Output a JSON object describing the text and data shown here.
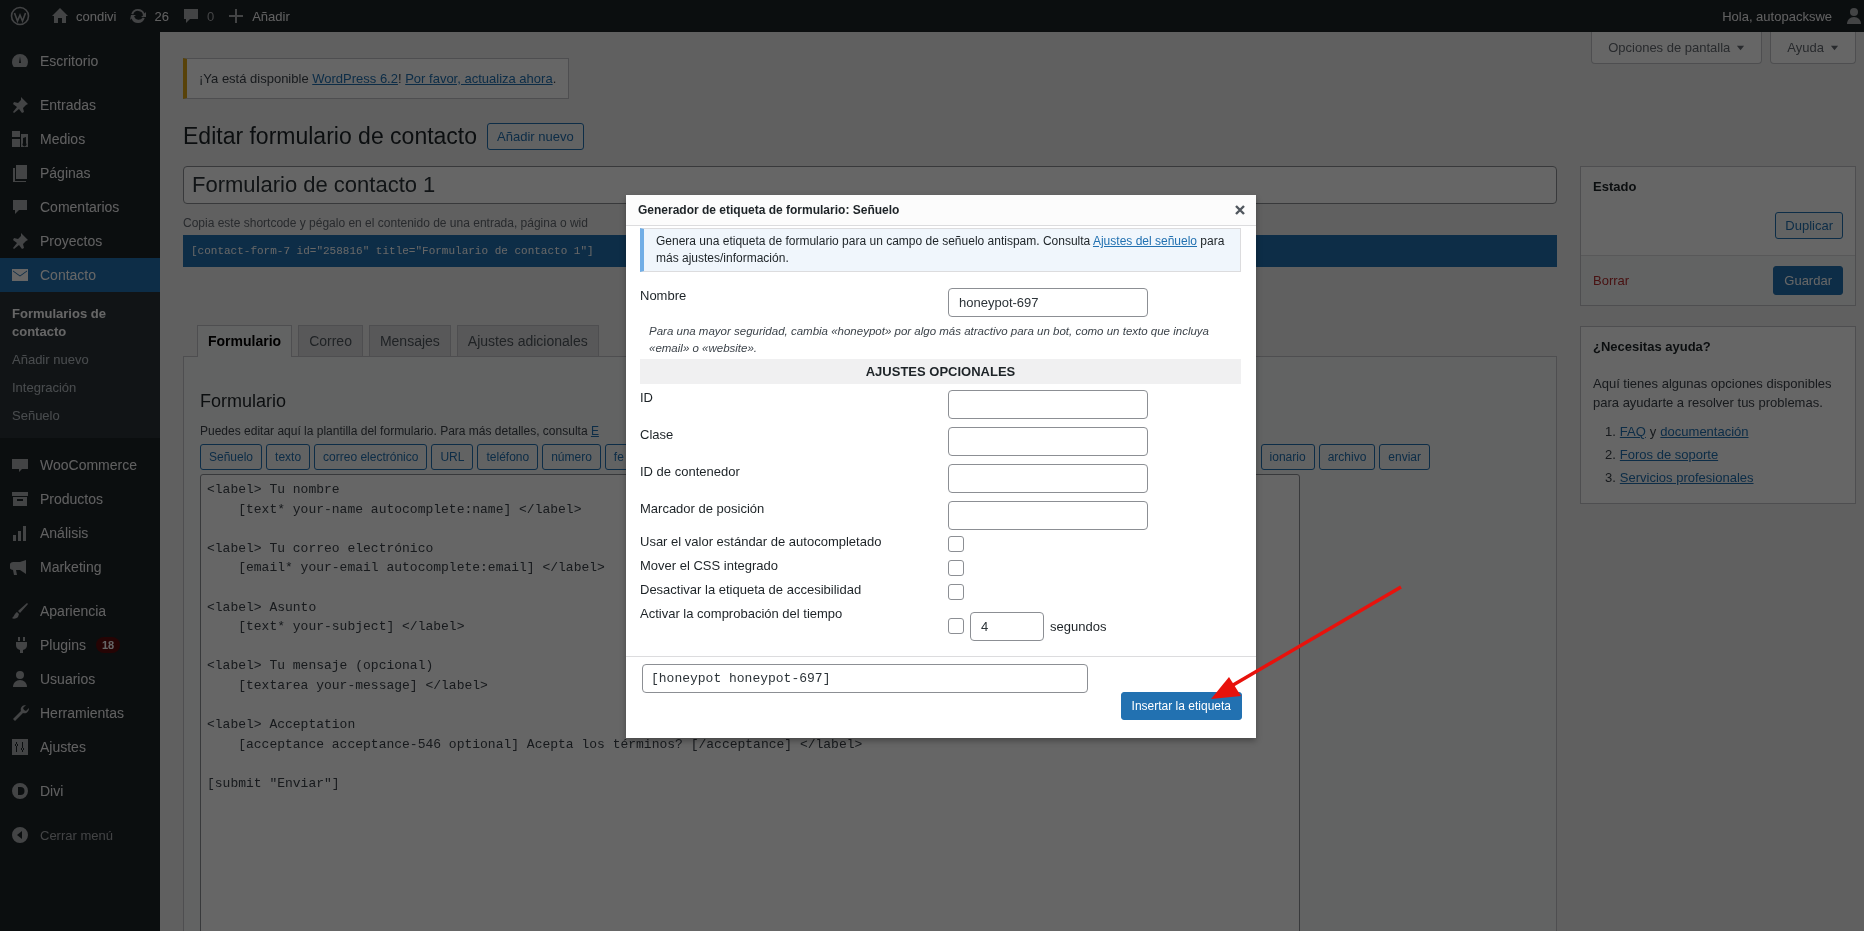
{
  "admin_bar": {
    "site": "condivi",
    "updates": "26",
    "comments": "0",
    "new": "Añadir",
    "greeting": "Hola, autopackswe"
  },
  "sidebar": {
    "groups": [
      [
        {
          "label": "Escritorio",
          "selected": false
        }
      ],
      [
        {
          "label": "Entradas",
          "selected": false
        },
        {
          "label": "Medios",
          "selected": false
        },
        {
          "label": "Páginas",
          "selected": false
        },
        {
          "label": "Comentarios",
          "selected": false
        },
        {
          "label": "Proyectos",
          "selected": false
        },
        {
          "label": "Contacto",
          "selected": true,
          "children": [
            {
              "label": "Formularios de contacto",
              "selected": true
            },
            {
              "label": "Añadir nuevo",
              "selected": false
            },
            {
              "label": "Integración",
              "selected": false
            },
            {
              "label": "Señuelo",
              "selected": false
            }
          ]
        }
      ],
      [
        {
          "label": "WooCommerce",
          "selected": false
        },
        {
          "label": "Productos",
          "selected": false
        },
        {
          "label": "Análisis",
          "selected": false
        },
        {
          "label": "Marketing",
          "selected": false
        }
      ],
      [
        {
          "label": "Apariencia",
          "selected": false
        },
        {
          "label": "Plugins",
          "selected": false,
          "badge": "18"
        },
        {
          "label": "Usuarios",
          "selected": false
        },
        {
          "label": "Herramientas",
          "selected": false
        },
        {
          "label": "Ajustes",
          "selected": false
        }
      ],
      [
        {
          "label": "Divi",
          "selected": false
        }
      ]
    ],
    "collapse_label": "Cerrar menú"
  },
  "screen_meta": [
    "Opciones de pantalla",
    "Ayuda"
  ],
  "notice": {
    "before": "¡Ya está disponible ",
    "link": "WordPress 6.2",
    "middle": "! ",
    "action": "Por favor, actualiza ahora",
    "after": "."
  },
  "page_title": "Editar formulario de contacto",
  "add_new": "Añadir nuevo",
  "form_title": "Formulario de contacto 1",
  "shortcode_hint": "Copia este shortcode y pégalo en el contenido de una entrada, página o wid",
  "shortcode": "[contact-form-7 id=\"258816\" title=\"Formulario de contacto 1\"]",
  "tabs": [
    {
      "label": "Formulario",
      "selected": true
    },
    {
      "label": "Correo",
      "selected": false
    },
    {
      "label": "Mensajes",
      "selected": false
    },
    {
      "label": "Ajustes adicionales",
      "selected": false
    }
  ],
  "panel": {
    "heading": "Formulario",
    "description": "Puedes editar aquí la plantilla del formulario. Para más detalles, consulta",
    "description_link": "E",
    "tag_buttons_left": [
      "Señuelo",
      "texto",
      "correo electrónico",
      "URL",
      "teléfono",
      "número",
      "fe"
    ],
    "tag_buttons_right": [
      "ionario",
      "archivo",
      "enviar"
    ],
    "editor": "<label> Tu nombre\n    [text* your-name autocomplete:name] </label>\n\n<label> Tu correo electrónico\n    [email* your-email autocomplete:email] </label>\n\n<label> Asunto\n    [text* your-subject] </label>\n\n<label> Tu mensaje (opcional)\n    [textarea your-message] </label>\n\n<label> Acceptation\n    [acceptance acceptance-546 optional] Acepta los términos? [/acceptance] </label>\n\n[submit \"Enviar\"]"
  },
  "status_box": {
    "title": "Estado",
    "duplicate": "Duplicar",
    "delete": "Borrar",
    "save": "Guardar"
  },
  "help_box": {
    "title": "¿Necesitas ayuda?",
    "text": "Aquí tienes algunas opciones disponibles para ayudarte a resolver tus problemas.",
    "items": [
      {
        "number": "1.",
        "parts": [
          {
            "text": "FAQ",
            "link": true
          },
          {
            "text": "y",
            "link": false
          },
          {
            "text": "documentación",
            "link": true
          }
        ]
      },
      {
        "number": "2.",
        "parts": [
          {
            "text": "Foros de soporte",
            "link": true
          }
        ]
      },
      {
        "number": "3.",
        "parts": [
          {
            "text": "Servicios profesionales",
            "link": true
          }
        ]
      }
    ]
  },
  "modal": {
    "title": "Generador de etiqueta de formulario: Señuelo",
    "info": "Genera una etiqueta de formulario para un campo de señuelo antispam. Consulta",
    "info_link": "Ajustes del señuelo",
    "info_after": "para más ajustes/información.",
    "name_label": "Nombre",
    "name_value": "honeypot-697",
    "hint": "Para una mayor seguridad, cambia «honeypot» por algo más atractivo para un bot, como un texto que incluya «email» o «website».",
    "section": "AJUSTES OPCIONALES",
    "fields": [
      {
        "kind": "text",
        "label": "ID"
      },
      {
        "kind": "text",
        "label": "Clase"
      },
      {
        "kind": "text",
        "label": "ID de contenedor"
      },
      {
        "kind": "text",
        "label": "Marcador de posición"
      },
      {
        "kind": "checkbox",
        "label": "Usar el valor estándar de autocompletado",
        "checked": false
      },
      {
        "kind": "checkbox",
        "label": "Mover el CSS integrado",
        "checked": false
      },
      {
        "kind": "checkbox",
        "label": "Desactivar la etiqueta de accesibilidad",
        "checked": false
      },
      {
        "kind": "timer",
        "label": "Activar la comprobación del tiempo",
        "checked": false,
        "value": "4",
        "unit": "segundos"
      }
    ],
    "code": "[honeypot honeypot-697]",
    "insert": "Insertar la etiqueta"
  }
}
